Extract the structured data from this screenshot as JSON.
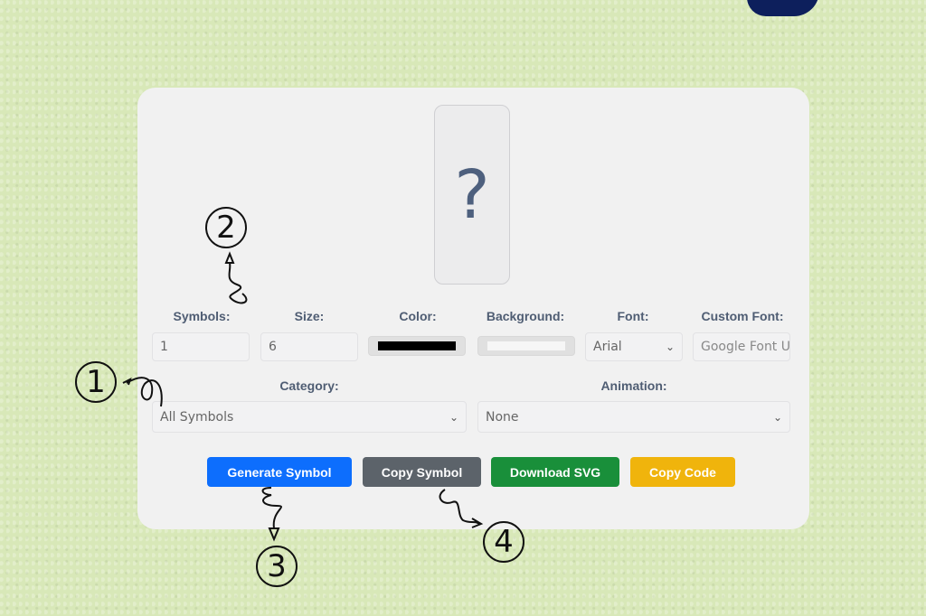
{
  "preview": {
    "symbol": "?"
  },
  "controls": {
    "symbols": {
      "label": "Symbols:",
      "value": "1"
    },
    "size": {
      "label": "Size:",
      "value": "6"
    },
    "color": {
      "label": "Color:",
      "value": "#000000"
    },
    "background": {
      "label": "Background:",
      "value": "#ffffff"
    },
    "font": {
      "label": "Font:",
      "value": "Arial"
    },
    "custom_font": {
      "label": "Custom Font:",
      "placeholder": "Google Font U"
    },
    "category": {
      "label": "Category:",
      "value": "All Symbols"
    },
    "animation": {
      "label": "Animation:",
      "value": "None"
    }
  },
  "buttons": {
    "generate": {
      "label": "Generate Symbol",
      "color": "#0d6efd"
    },
    "copy_symbol": {
      "label": "Copy Symbol",
      "color": "#5c636a"
    },
    "download_svg": {
      "label": "Download SVG",
      "color": "#198f3a"
    },
    "copy_code": {
      "label": "Copy Code",
      "color": "#f0b40c"
    }
  },
  "annotations": [
    "1",
    "2",
    "3",
    "4"
  ],
  "icons": {
    "chevron": "⌄"
  }
}
